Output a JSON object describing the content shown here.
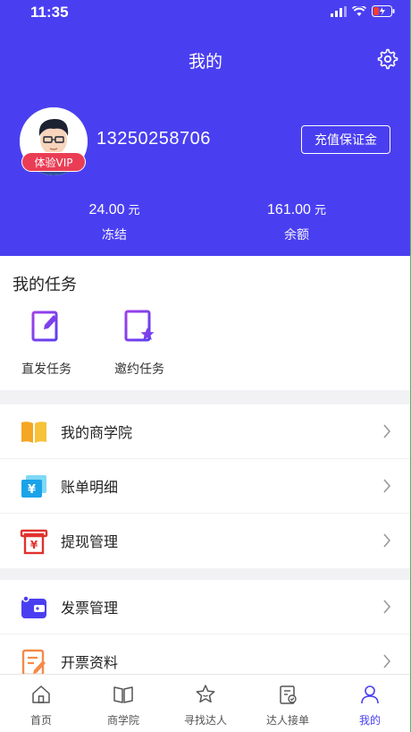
{
  "status": {
    "time": "11:35"
  },
  "nav": {
    "title": "我的"
  },
  "profile": {
    "phone": "13250258706",
    "vip_badge": "体验VIP",
    "deposit_button": "充值保证金"
  },
  "stats": [
    {
      "value": "24.00",
      "unit": "元",
      "label": "冻结"
    },
    {
      "value": "161.00",
      "unit": "元",
      "label": "余额"
    }
  ],
  "tasks": {
    "title": "我的任务",
    "items": [
      {
        "label": "直发任务"
      },
      {
        "label": "邀约任务"
      }
    ]
  },
  "menu1": [
    {
      "label": "我的商学院",
      "icon": "book-icon"
    },
    {
      "label": "账单明细",
      "icon": "bill-icon"
    },
    {
      "label": "提现管理",
      "icon": "withdraw-icon"
    }
  ],
  "menu2": [
    {
      "label": "发票管理",
      "icon": "wallet-icon"
    },
    {
      "label": "开票资料",
      "icon": "document-edit-icon"
    }
  ],
  "tabbar": [
    {
      "label": "首页",
      "icon": "home-icon"
    },
    {
      "label": "商学院",
      "icon": "book-open-icon"
    },
    {
      "label": "寻找达人",
      "icon": "star-face-icon"
    },
    {
      "label": "达人接单",
      "icon": "clipboard-check-icon"
    },
    {
      "label": "我的",
      "icon": "user-icon",
      "active": true
    }
  ],
  "colors": {
    "primary": "#4a3ff0",
    "vip": "#ea3d55"
  }
}
